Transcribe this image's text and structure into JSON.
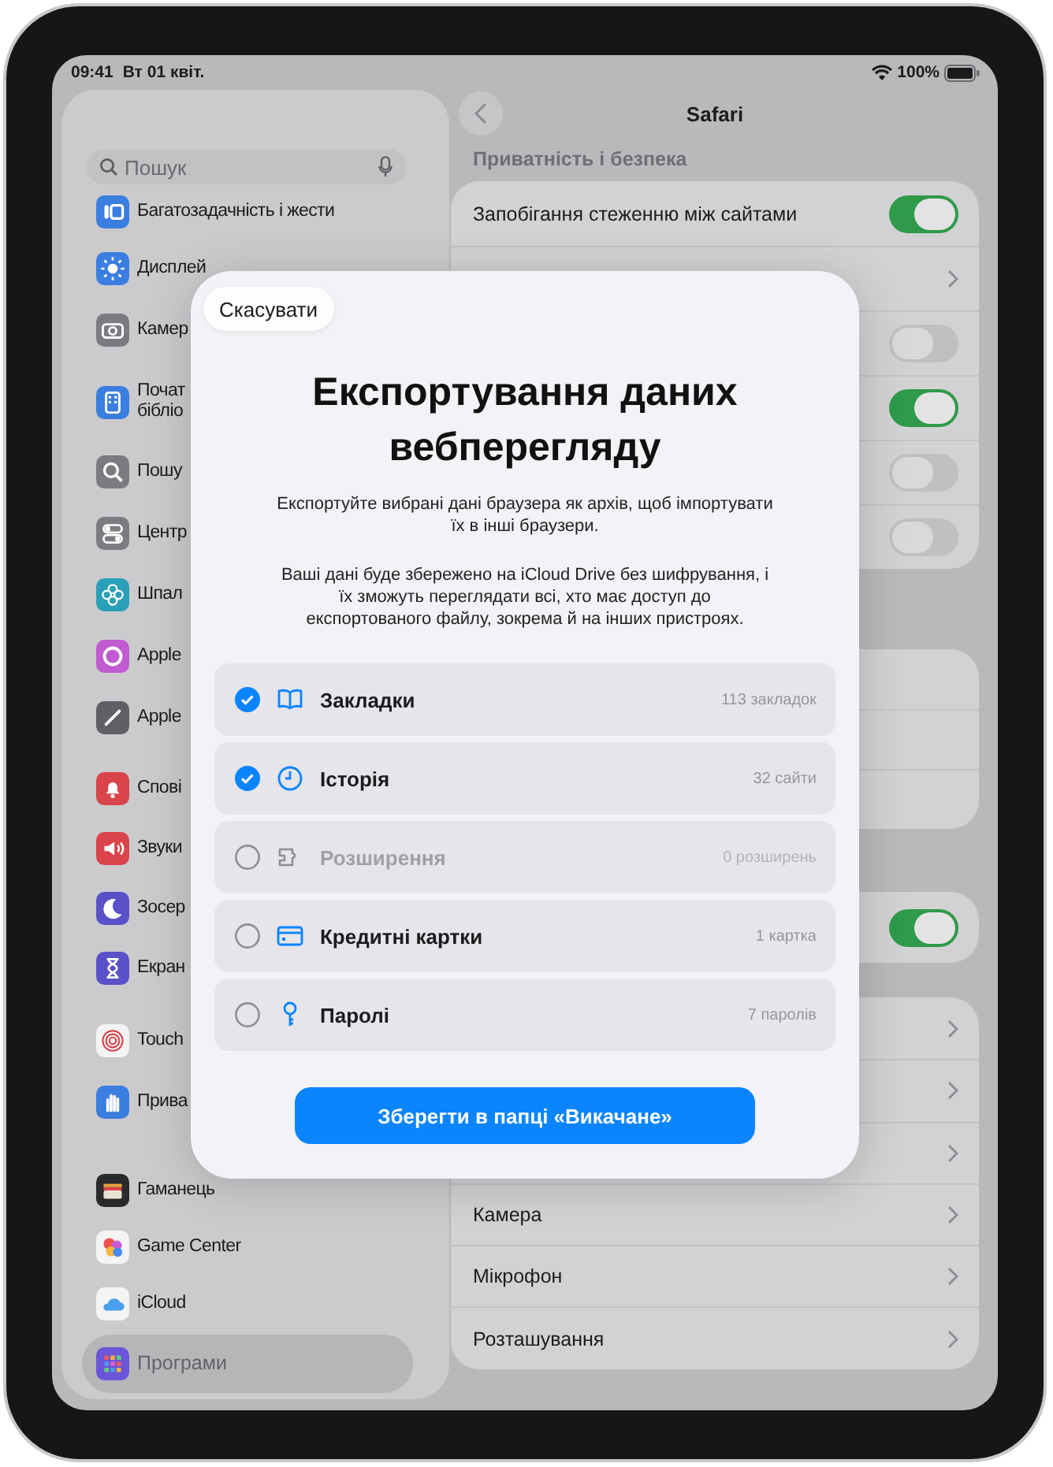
{
  "status_bar": {
    "time": "09:41",
    "date": "Вт 01 квіт.",
    "battery": "100%"
  },
  "sidebar": {
    "search": {
      "placeholder": "Пошук"
    },
    "groups": [
      [
        {
          "label": "Багатозадачність і жести",
          "selected": false
        },
        {
          "label": "Дисплей",
          "selected": false
        },
        {
          "label": "Камер",
          "selected": false
        },
        {
          "label": "Почат\nбібліо",
          "selected": false
        },
        {
          "label": "Пошу",
          "selected": false
        },
        {
          "label": "Центр",
          "selected": false
        },
        {
          "label": "Шпал",
          "selected": false
        },
        {
          "label": "Apple",
          "selected": false
        },
        {
          "label": "Apple",
          "selected": false
        }
      ],
      [
        {
          "label": "Спові",
          "selected": false
        },
        {
          "label": "Звуки",
          "selected": false
        },
        {
          "label": "Зосер",
          "selected": false
        },
        {
          "label": "Екран",
          "selected": false
        }
      ],
      [
        {
          "label": "Touch",
          "selected": false
        },
        {
          "label": "Прива",
          "selected": false
        }
      ],
      [
        {
          "label": "Гаманець",
          "selected": false
        },
        {
          "label": "Game Center",
          "selected": false
        },
        {
          "label": "iCloud",
          "selected": false
        }
      ],
      [
        {
          "label": "Програми",
          "selected": true
        }
      ]
    ]
  },
  "detail": {
    "title": "Safari",
    "section_header": "Приватність і безпека",
    "groups": [
      {
        "rows": [
          {
            "kind": "toggle",
            "label": "Запобігання стеженню між сайтами",
            "on": true
          },
          {
            "kind": "link"
          },
          {
            "kind": "toggle",
            "on": false
          },
          {
            "kind": "toggle",
            "on": true
          },
          {
            "kind": "toggle",
            "on": false
          },
          {
            "kind": "toggle",
            "on": false
          }
        ]
      },
      {
        "rows": [
          {
            "kind": "plain"
          },
          {
            "kind": "plain"
          },
          {
            "kind": "plain"
          }
        ]
      },
      {
        "rows": [
          {
            "kind": "toggle",
            "on": true
          }
        ]
      },
      {
        "rows": [
          {
            "kind": "link"
          },
          {
            "kind": "link"
          },
          {
            "kind": "link"
          },
          {
            "kind": "link",
            "label": "Камера"
          },
          {
            "kind": "link",
            "label": "Мікрофон"
          },
          {
            "kind": "link",
            "label": "Розташування"
          }
        ]
      }
    ]
  },
  "sheet": {
    "cancel": "Скасувати",
    "title": "Експортування даних вебперегляду",
    "paragraphs": [
      "Експортуйте вибрані дані браузера як архів, щоб імпортувати їх в інші браузери.",
      "Ваші дані буде збережено на iCloud Drive без шифрування, і їх зможуть переглядати всі, хто має доступ до експортованого файлу, зокрема й на інших пристроях."
    ],
    "items": [
      {
        "label": "Закладки",
        "count": "113 закладок",
        "checked": true,
        "disabled": false
      },
      {
        "label": "Історія",
        "count": "32 сайти",
        "checked": true,
        "disabled": false
      },
      {
        "label": "Розширення",
        "count": "0 розширень",
        "checked": false,
        "disabled": true
      },
      {
        "label": "Кредитні картки",
        "count": "1 картка",
        "checked": false,
        "disabled": false
      },
      {
        "label": "Паролі",
        "count": "7 паролів",
        "checked": false,
        "disabled": false
      }
    ],
    "action": "Зберегти в папці «Викачане»"
  }
}
